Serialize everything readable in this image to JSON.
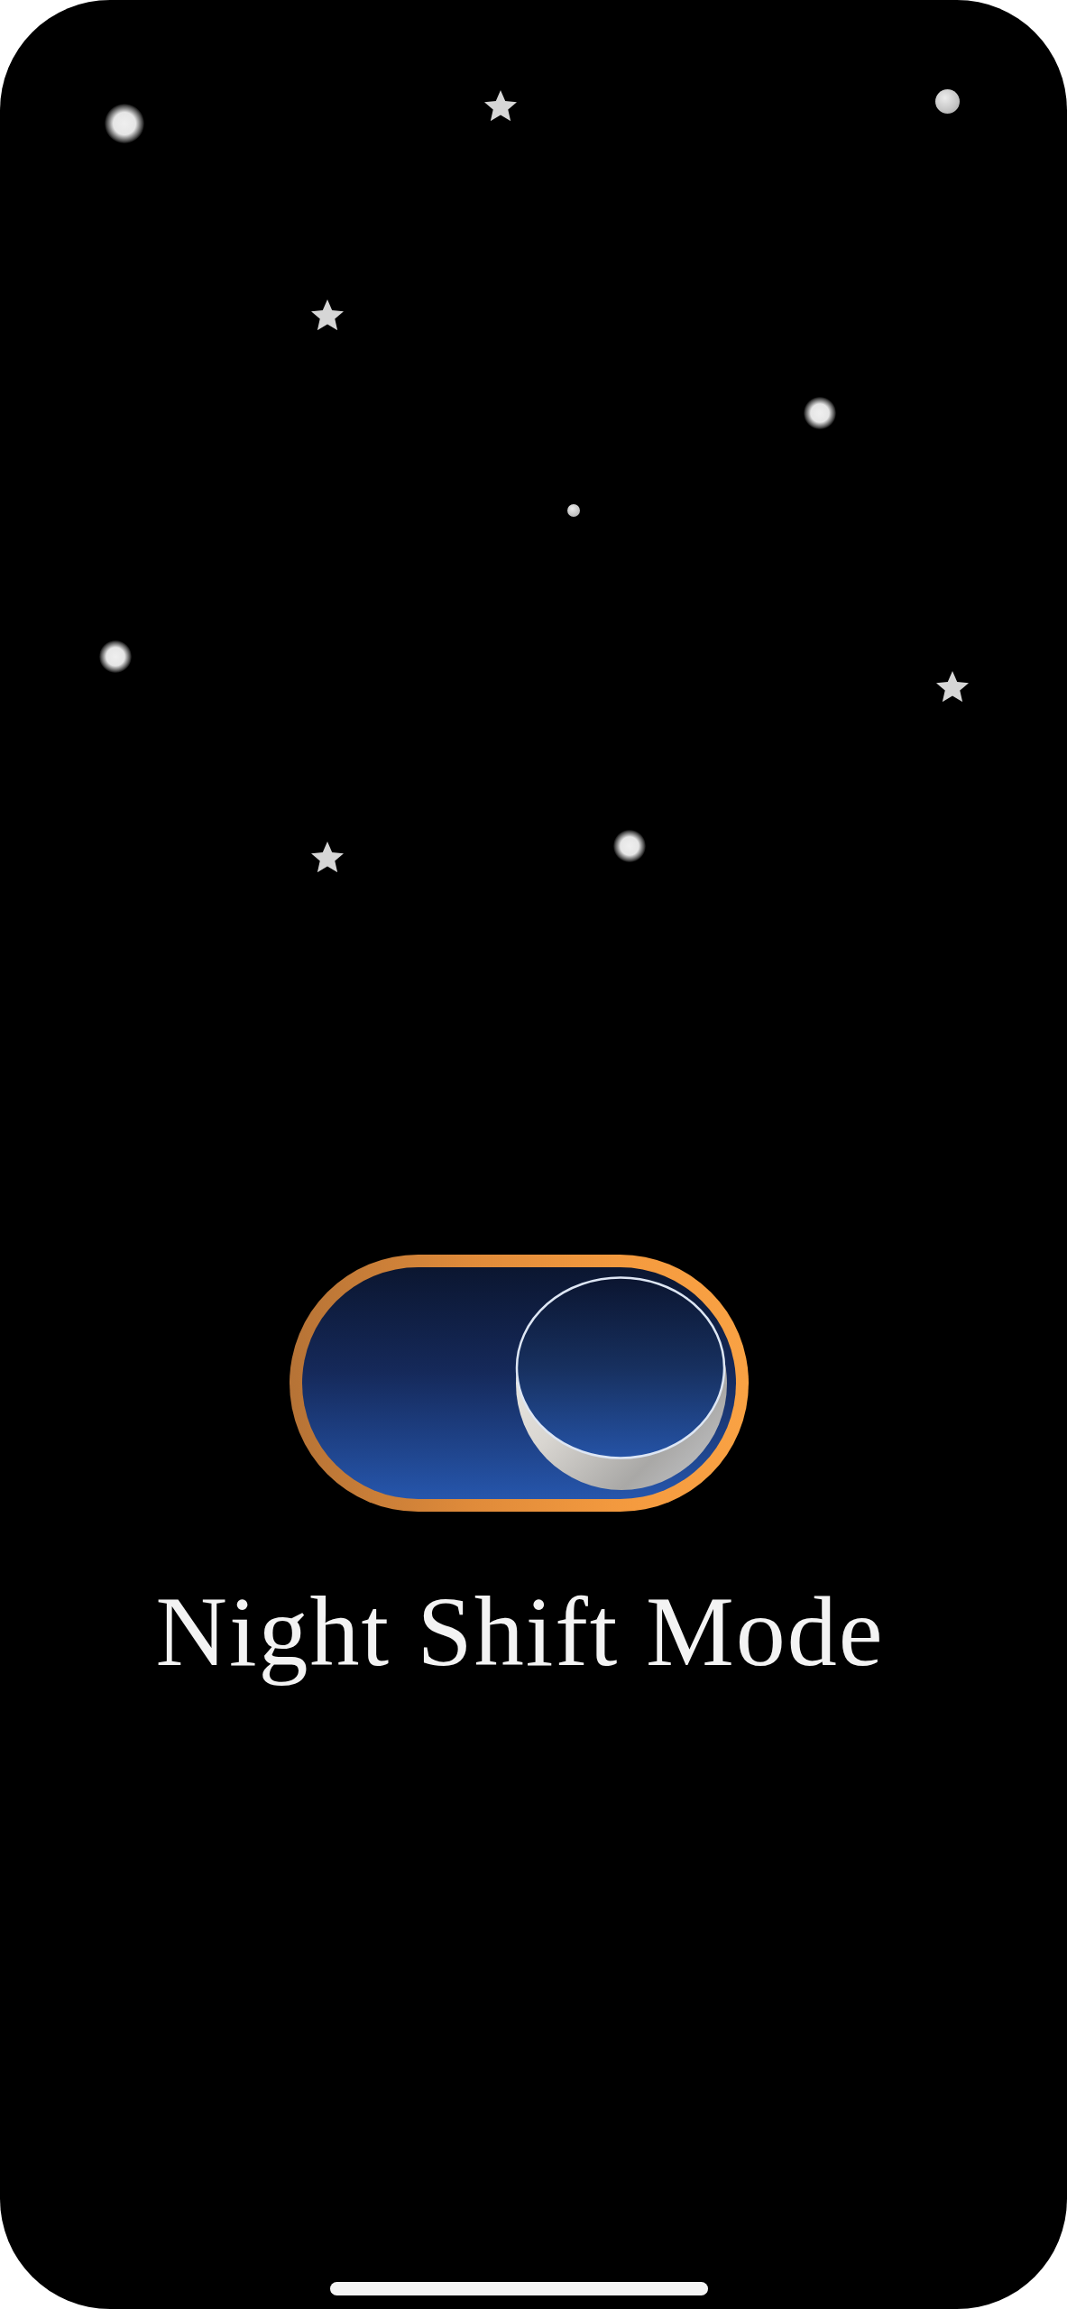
{
  "toggle": {
    "on": true,
    "label": "Night Shift Mode"
  }
}
